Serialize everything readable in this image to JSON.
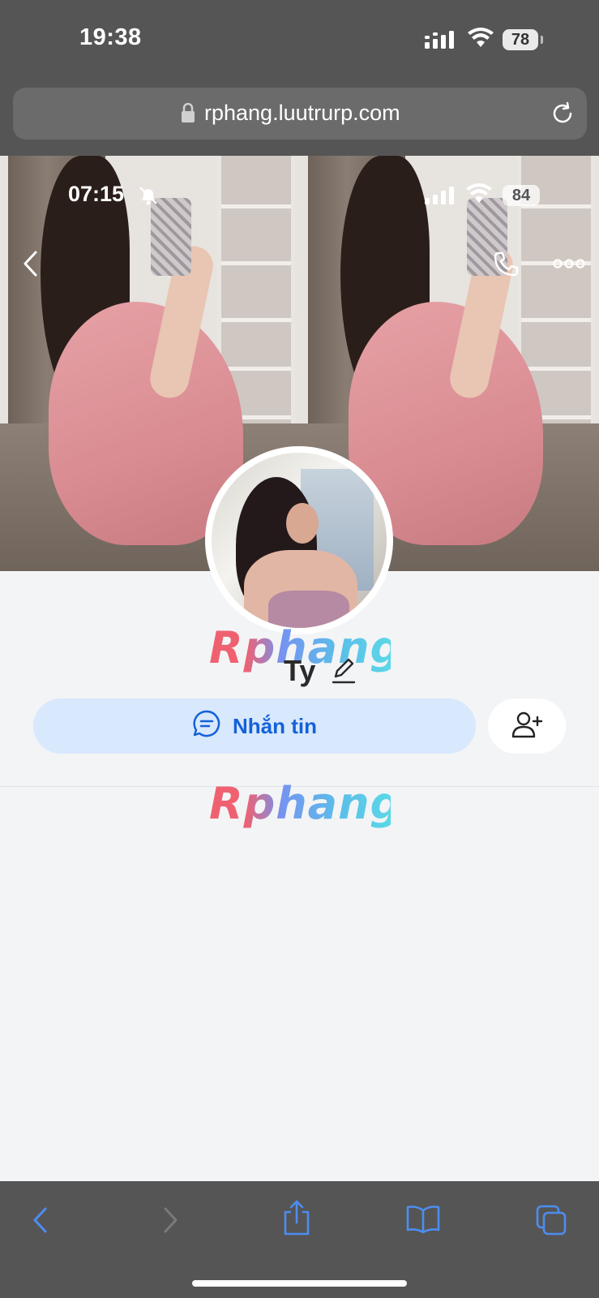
{
  "status_bar": {
    "time": "19:38",
    "battery": "78"
  },
  "browser": {
    "url": "rphang.luutrurp.com"
  },
  "cover_overlay": {
    "time": "07:15",
    "battery": "84"
  },
  "watermark": {
    "text": "Rphang"
  },
  "profile": {
    "name": "Ty",
    "message_label": "Nhắn tin"
  },
  "icons": {
    "signal": "signal-icon",
    "wifi": "wifi-icon",
    "lock": "lock-icon",
    "reload": "reload-icon",
    "bell_muted": "bell-muted-icon",
    "back": "chevron-left-icon",
    "phone": "phone-icon",
    "more": "more-icon",
    "edit": "pencil-icon",
    "chat": "chat-bubble-icon",
    "add_friend": "add-user-icon",
    "nav_back": "nav-back-icon",
    "nav_forward": "nav-forward-icon",
    "share": "share-icon",
    "bookmarks": "book-icon",
    "tabs": "tabs-icon"
  },
  "colors": {
    "accent": "#1461d9",
    "message_button_bg": "#d8e8fd",
    "chrome_bg": "#555555",
    "page_bg": "#f3f4f6",
    "toolbar_icon": "#4d8df0"
  }
}
